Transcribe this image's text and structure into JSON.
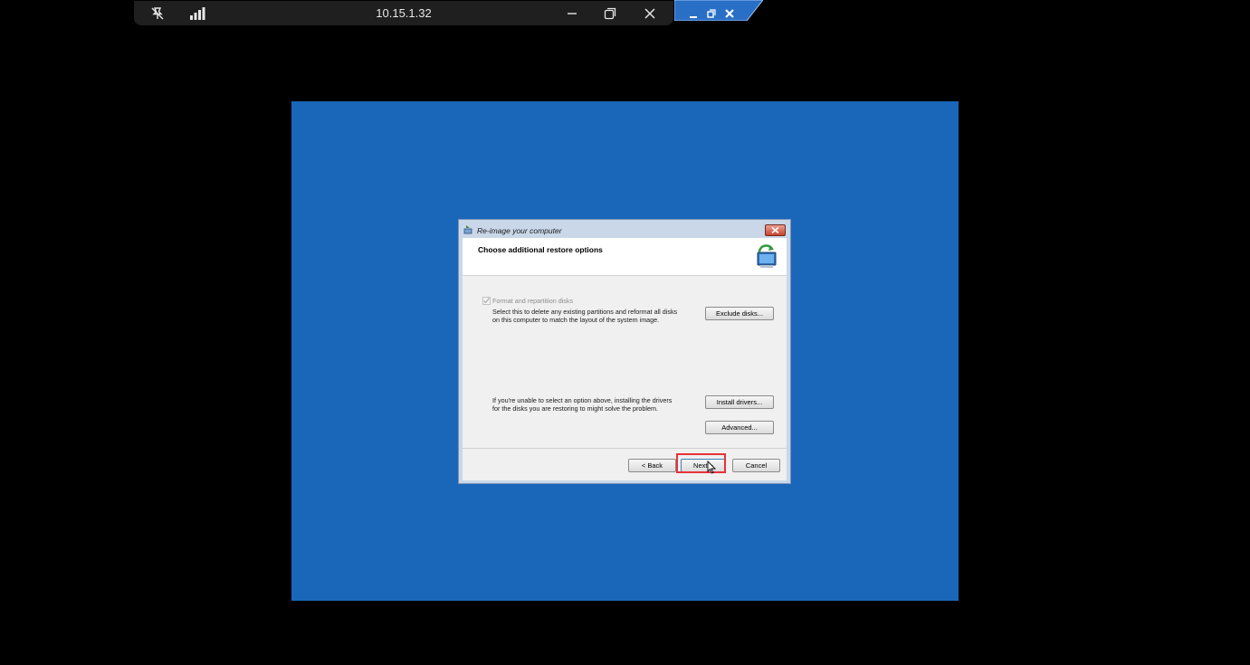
{
  "remote_bar": {
    "host": "10.15.1.32",
    "icons": [
      "pin-off-icon",
      "signal-icon",
      "minimize-icon",
      "restore-icon",
      "close-icon"
    ]
  },
  "mini_controls": {
    "icons": [
      "minimize-icon",
      "restore-icon",
      "close-icon"
    ]
  },
  "screen": {
    "background": "#1a67b9"
  },
  "dialog": {
    "title": "Re-image your computer",
    "heading": "Choose additional restore options",
    "format_checkbox_label": "Format and repartition disks",
    "format_description_line1": "Select this to delete any existing partitions and reformat all disks",
    "format_description_line2": "on this computer to match the layout of the system image.",
    "exclude_label": "Exclude disks...",
    "drivers_text_line1": "If you're unable to select an option above, installing the drivers",
    "drivers_text_line2": "for the disks you are restoring to might solve the problem.",
    "install_drivers_label": "Install drivers...",
    "advanced_label": "Advanced...",
    "back_label": "< Back",
    "next_label": "Next >",
    "cancel_label": "Cancel"
  },
  "colors": {
    "highlight": "#e8323a",
    "dialog_frame": "#c9d7e8"
  }
}
